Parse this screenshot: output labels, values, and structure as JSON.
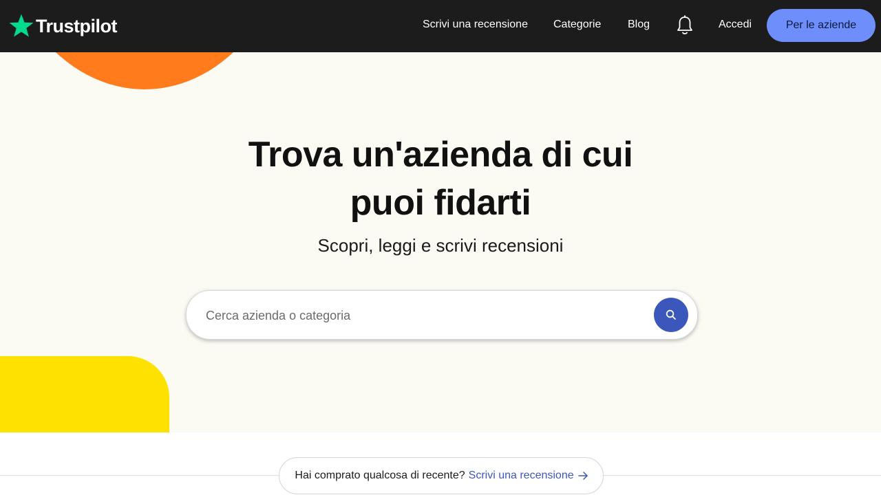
{
  "header": {
    "logo_text": "Trustpilot",
    "nav": {
      "write_review": "Scrivi una recensione",
      "categories": "Categorie",
      "blog": "Blog",
      "login": "Accedi"
    },
    "business_button": "Per le aziende",
    "icons": [
      "star-logo-icon",
      "bell-icon"
    ]
  },
  "hero": {
    "title_line1": "Trova un'azienda di cui",
    "title_line2": "puoi fidarti",
    "subtitle": "Scopri, leggi e scrivi recensioni",
    "search": {
      "placeholder": "Cerca azienda o categoria",
      "value": "",
      "icon": "search-icon"
    }
  },
  "prompt": {
    "text": "Hai comprato qualcosa di recente?",
    "link": "Scrivi una recensione",
    "icon": "arrow-right-icon"
  },
  "colors": {
    "header_bg": "#1c1c1c",
    "brand_green": "#04da8d",
    "business_button": "#6e8ffb",
    "hero_bg": "#fbfaf3",
    "accent_orange": "#ff7b1c",
    "accent_yellow": "#ffe100",
    "search_button": "#3c57bc",
    "link_blue": "#3c57bc"
  }
}
